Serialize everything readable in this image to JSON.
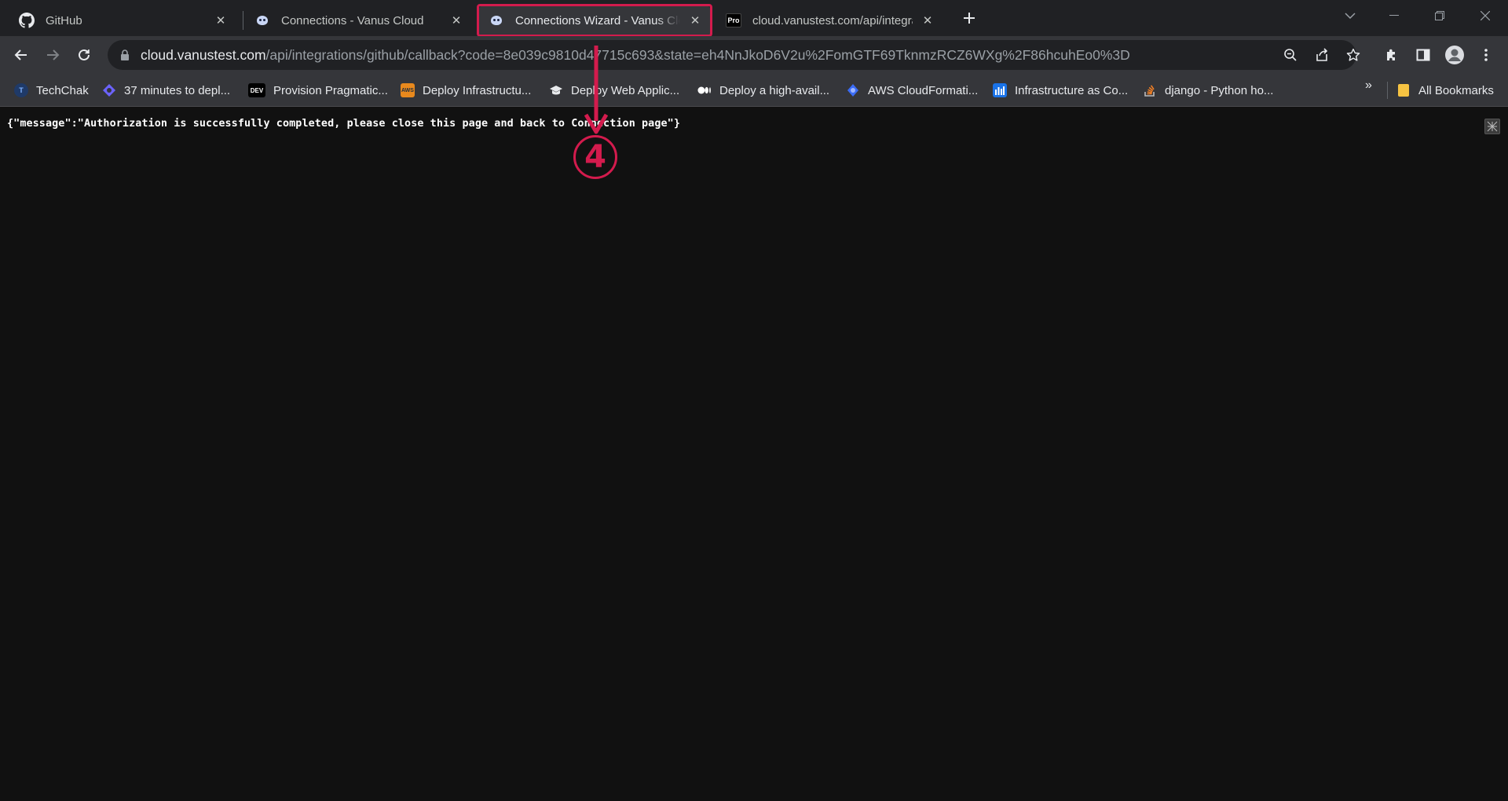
{
  "tabs": [
    {
      "title": "GitHub",
      "favicon": "github-icon"
    },
    {
      "title": "Connections - Vanus Cloud",
      "favicon": "vanus-icon"
    },
    {
      "title": "Connections Wizard - Vanus Clo",
      "favicon": "vanus-icon",
      "active": true
    },
    {
      "title": "cloud.vanustest.com/api/integra",
      "favicon": "pro-icon",
      "favicon_text": "Pro"
    }
  ],
  "omnibox": {
    "host": "cloud.vanustest.com",
    "path": "/api/integrations/github/callback?code=8e039c9810d47715c693&state=eh4NnJkoD6V2u%2FomGTF69TknmzRCZ6WXg%2F86hcuhEo0%3D"
  },
  "bookmarks": [
    {
      "label": "TechChak",
      "icon": "techchak-icon"
    },
    {
      "label": "37 minutes to depl...",
      "icon": "hashnode-icon"
    },
    {
      "label": "Provision Pragmatic...",
      "icon": "dev-icon",
      "icon_text": "DEV"
    },
    {
      "label": "Deploy Infrastructu...",
      "icon": "aws-icon",
      "icon_text": "AWS"
    },
    {
      "label": "Deploy Web Applic...",
      "icon": "graduation-cap-icon"
    },
    {
      "label": "Deploy a high-avail...",
      "icon": "medium-icon"
    },
    {
      "label": "AWS CloudFormati...",
      "icon": "cloudformation-icon"
    },
    {
      "label": "Infrastructure as Co...",
      "icon": "chart-bars-icon"
    },
    {
      "label": "django - Python ho...",
      "icon": "stackoverflow-icon"
    }
  ],
  "all_bookmarks_label": "All Bookmarks",
  "page": {
    "json_response": "{\"message\":\"Authorization is successfully completed, please close this page and back to Connection page\"}"
  },
  "annotation": {
    "step_number": "4",
    "color": "#d31b4d"
  },
  "colors": {
    "tabstrip_bg": "#202124",
    "toolbar_bg": "#35363a",
    "page_bg": "#111111",
    "annotation": "#d31b4d"
  }
}
